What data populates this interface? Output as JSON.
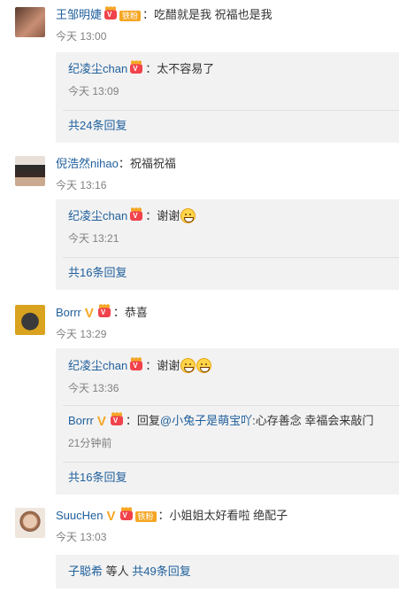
{
  "comments": [
    {
      "user": "王邹明婕",
      "fan_badge": "铁粉",
      "text": "：吃醋就是我 祝福也是我",
      "time": "今天 13:00",
      "avatar_colors": [
        "#6b4a3a",
        "#c98f75"
      ],
      "replies": [
        {
          "user": "纪凌尘chan",
          "text": "：太不容易了",
          "time": "今天 13:09"
        }
      ],
      "more": "共24条回复"
    },
    {
      "user": "倪浩然nihao",
      "text": "：祝福祝福",
      "time": "今天 13:16",
      "avatar_colors": [
        "#2b2b2b",
        "#c9a98f"
      ],
      "replies": [
        {
          "user": "纪凌尘chan",
          "text": "：谢谢",
          "time": "今天 13:21",
          "emoji_count": 1
        }
      ],
      "more": "共16条回复"
    },
    {
      "user": "Borrr",
      "text": "：恭喜",
      "time": "今天 13:29",
      "avatar_colors": [
        "#d9a31f",
        "#3a3a3a"
      ],
      "replies": [
        {
          "user": "纪凌尘chan",
          "text": "：谢谢",
          "time": "今天 13:36",
          "emoji_count": 2
        },
        {
          "user": "Borrr",
          "text_prefix": "：回复",
          "mention": "@小兔子是萌宝吖",
          "text": ":心存善念 幸福会来敲门",
          "time": "21分钟前"
        }
      ],
      "more": "共16条回复"
    },
    {
      "user": "SuucHen",
      "fan_badge": "铁粉",
      "text": "：小姐姐太好看啦 绝配子",
      "time": "今天 13:03",
      "avatar_colors": [
        "#e8d6c8",
        "#b08060"
      ],
      "summary": {
        "user": "子聪希",
        "mid": " 等人 ",
        "more": "共49条回复"
      }
    }
  ],
  "colors": {
    "link": "#1f5f9c",
    "time": "#808080",
    "reply_bg": "#f2f2f2",
    "vip_red": "#f1424b",
    "badge_orange": "#f5a623"
  }
}
